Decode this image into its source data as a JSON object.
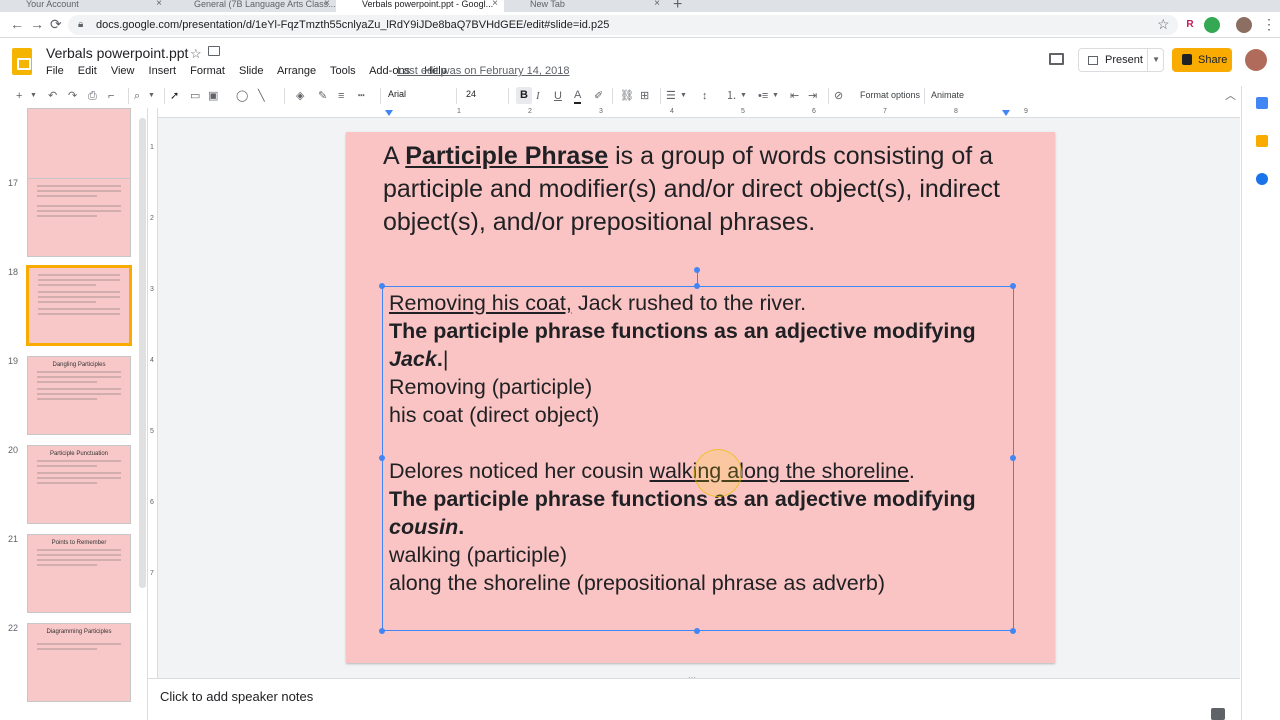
{
  "browser": {
    "tabs": [
      {
        "label": "Your Account"
      },
      {
        "label": "General (7B Language Arts Class..."
      },
      {
        "label": "Verbals powerpoint.ppt - Googl..."
      },
      {
        "label": "New Tab"
      }
    ],
    "url": "docs.google.com/presentation/d/1eYl-FqzTmzth55cnlyaZu_lRdY9iJDe8baQ7BVHdGEE/edit#slide=id.p25",
    "profile_initial": "R"
  },
  "doc": {
    "title": "Verbals powerpoint.ppt",
    "menu": [
      "File",
      "Edit",
      "View",
      "Insert",
      "Format",
      "Slide",
      "Arrange",
      "Tools",
      "Add-ons",
      "Help"
    ],
    "last_edit": "Last edit was on February 14, 2018",
    "present_label": "Present",
    "share_label": "Share"
  },
  "toolbar": {
    "font_name": "Arial",
    "font_size": "24",
    "format_options": "Format options",
    "animate": "Animate"
  },
  "ruler": {
    "h_marks": [
      "1",
      "2",
      "3",
      "4",
      "5",
      "6",
      "7",
      "8",
      "9"
    ],
    "v_marks": [
      "1",
      "2",
      "3",
      "4",
      "5",
      "6",
      "7"
    ]
  },
  "filmstrip": {
    "slides": [
      {
        "num": "",
        "title": ""
      },
      {
        "num": "17",
        "title": ""
      },
      {
        "num": "18",
        "title": ""
      },
      {
        "num": "19",
        "title": "Dangling Participles"
      },
      {
        "num": "20",
        "title": "Participle Punctuation"
      },
      {
        "num": "21",
        "title": "Points to Remember"
      },
      {
        "num": "22",
        "title": "Diagramming Participles"
      }
    ]
  },
  "slide": {
    "title_a": "A ",
    "title_bold": "Participle Phrase",
    "title_rest": " is a group of words consisting of a participle and modifier(s) and/or direct object(s), indirect object(s), and/or prepositional phrases.",
    "body": {
      "l1_u": "Removing his coat,",
      "l1_rest": " Jack rushed to the river.",
      "l2": "The participle phrase functions as an adjective modifying ",
      "l2_i": "Jack",
      "l2_end": ".",
      "l3": "Removing (participle)",
      "l4": "his coat (direct object)",
      "l5_a": "Delores noticed her cousin ",
      "l5_u": "walking along the shoreline",
      "l5_end": ".",
      "l6": "The participle phrase functions as an adjective modifying ",
      "l6_i": "cousin",
      "l6_end": ".",
      "l7": "walking (participle)",
      "l8": "along the shoreline (prepositional phrase as adverb)"
    }
  },
  "notes": {
    "placeholder": "Click to add speaker notes"
  },
  "colors": {
    "slide_bg": "#fbc4c4",
    "accent": "#f9ab00",
    "selection": "#4285f4"
  }
}
